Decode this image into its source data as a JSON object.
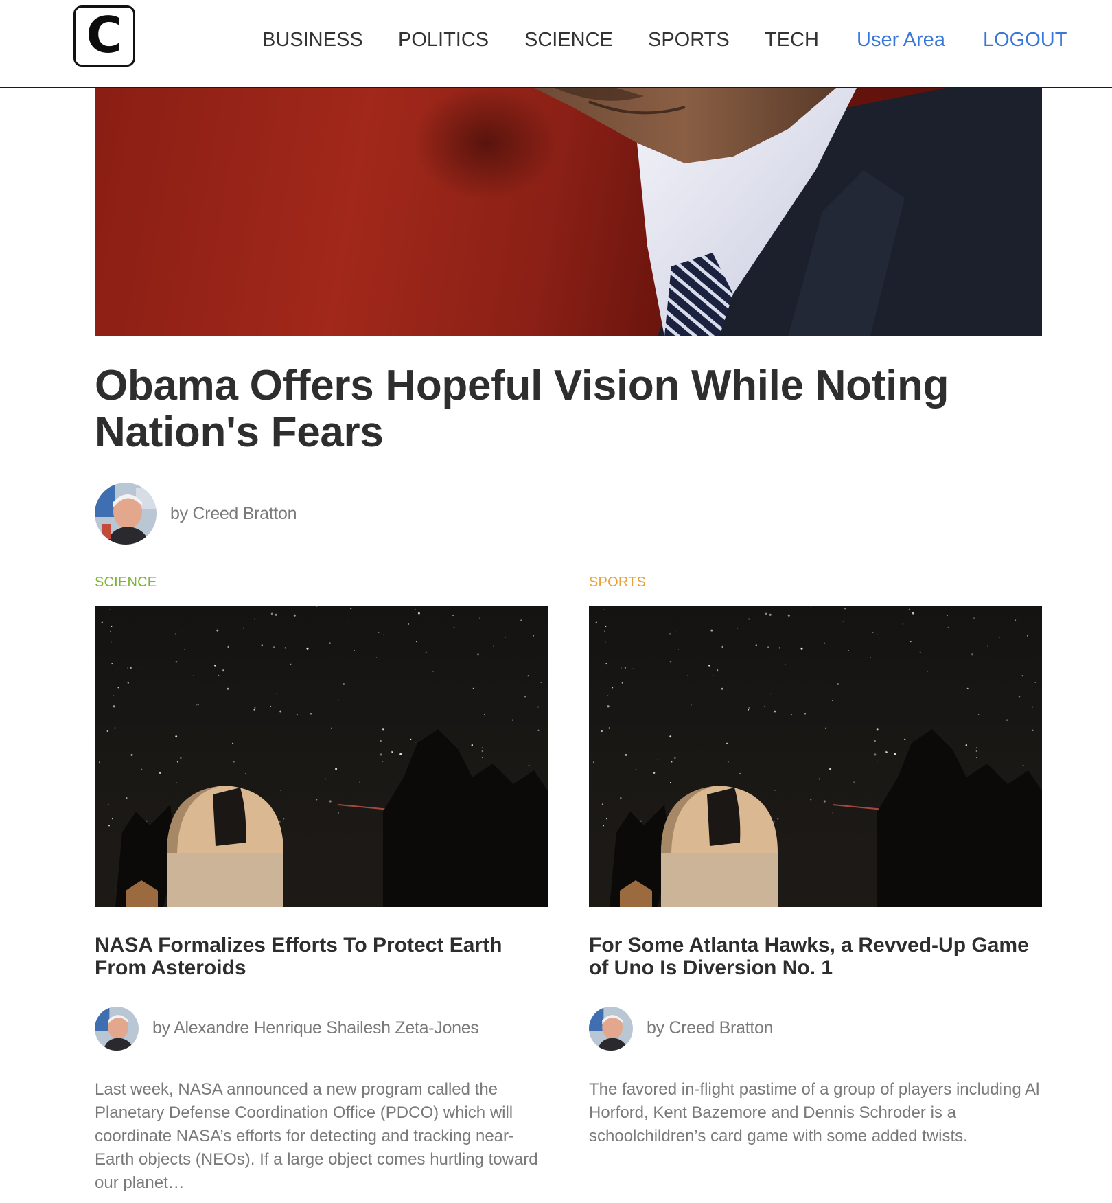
{
  "header": {
    "logo_letter": "C",
    "nav": [
      {
        "label": "BUSINESS"
      },
      {
        "label": "POLITICS"
      },
      {
        "label": "SCIENCE"
      },
      {
        "label": "SPORTS"
      },
      {
        "label": "TECH"
      },
      {
        "label": "User Area"
      },
      {
        "label": "LOGOUT"
      }
    ]
  },
  "featured": {
    "headline": "Obama Offers Hopeful Vision While Noting Nation's Fears",
    "byline": "by Creed Bratton"
  },
  "cards": [
    {
      "category": "SCIENCE",
      "title": "NASA Formalizes Efforts To Protect Earth From Asteroids",
      "byline": "by Alexandre Henrique Shailesh Zeta-Jones",
      "summary": "Last week, NASA announced a new program called the Planetary Defense Coordination Office (PDCO) which will coordinate NASA’s efforts for detecting and tracking near-Earth objects (NEOs). If a large object comes hurtling toward our planet…"
    },
    {
      "category": "SPORTS",
      "title": "For Some Atlanta Hawks, a Revved-Up Game of Uno Is Diversion No. 1",
      "byline": "by Creed Bratton",
      "summary": "The favored in-flight pastime of a group of players including Al Horford, Kent Bazemore and Dennis Schroder is a schoolchildren’s card game with some added twists."
    }
  ],
  "colors": {
    "nav_text": "#333333",
    "nav_accent": "#3877d9",
    "science_category": "#7bb536",
    "sports_category": "#e8a23a",
    "muted_text": "#7a7a7a",
    "headline_text": "#2e2e2e"
  }
}
